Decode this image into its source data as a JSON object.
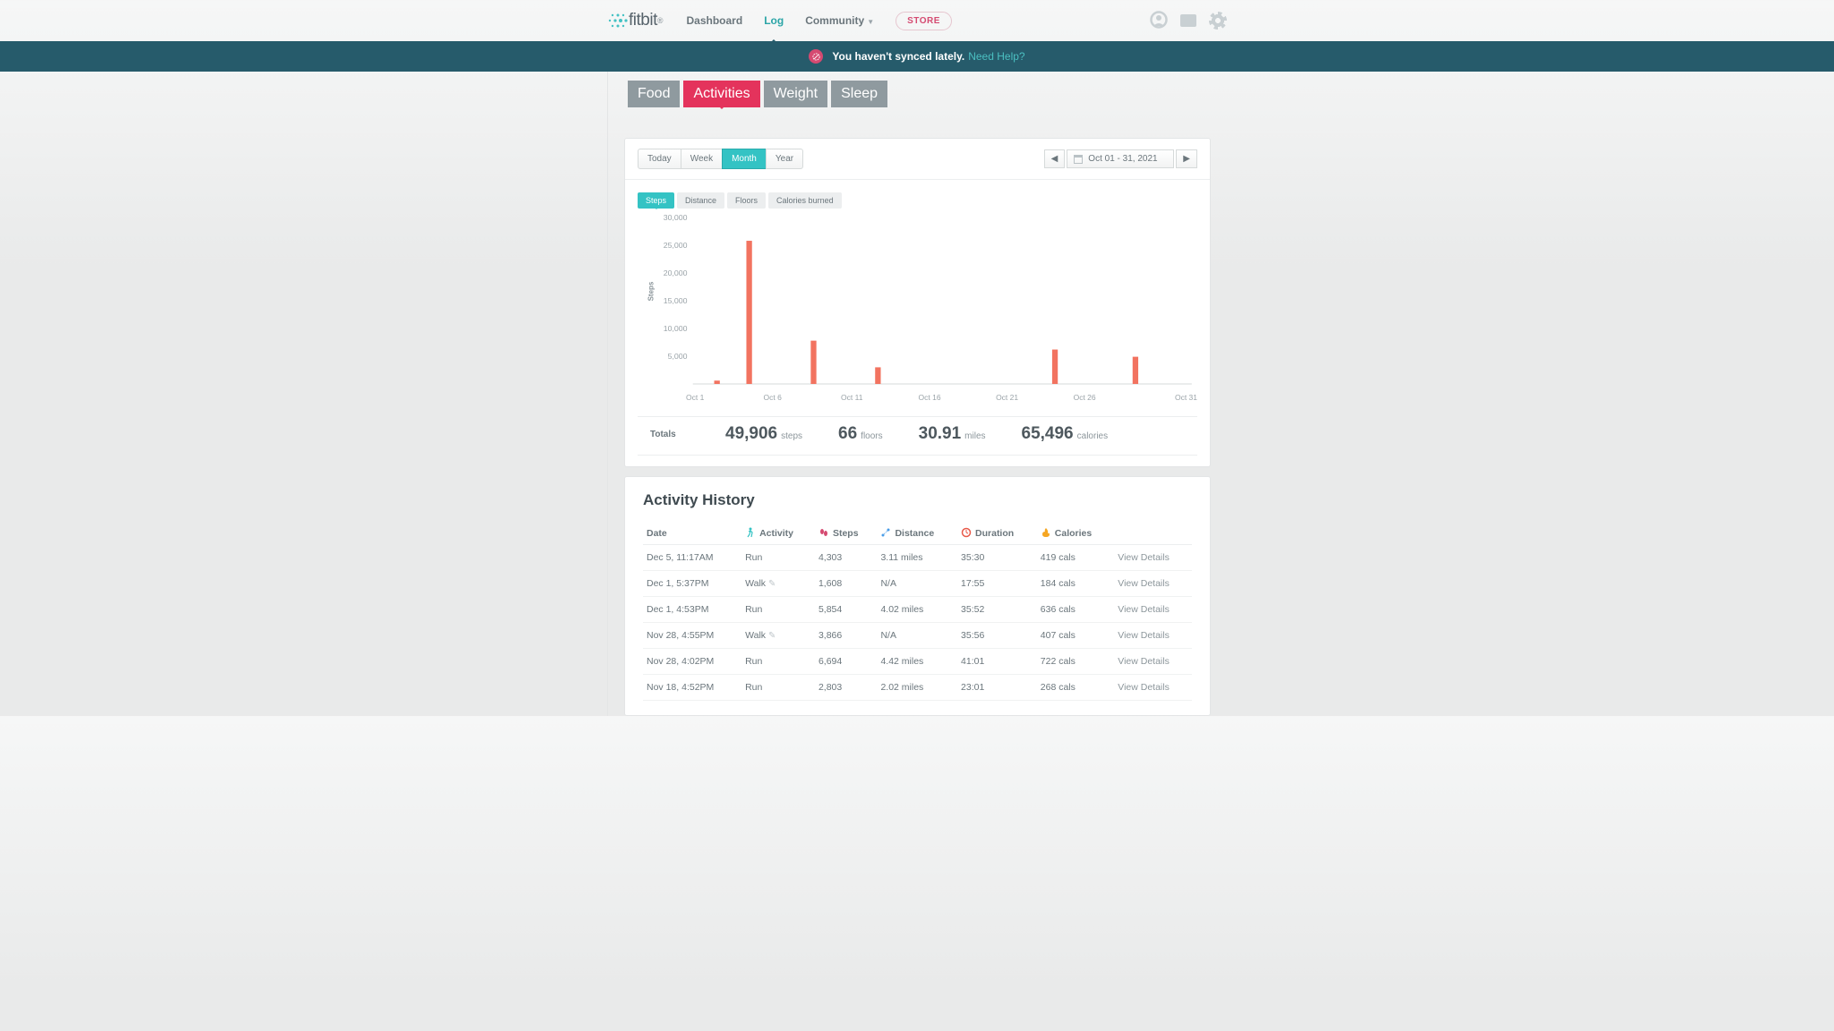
{
  "brand": "fitbit",
  "nav": {
    "dashboard": "Dashboard",
    "log": "Log",
    "community": "Community",
    "store": "STORE"
  },
  "sync_banner": {
    "message": "You haven't synced lately.",
    "help": "Need Help?"
  },
  "log_tabs": {
    "food": "Food",
    "activities": "Activities",
    "weight": "Weight",
    "sleep": "Sleep"
  },
  "period_tabs": {
    "today": "Today",
    "week": "Week",
    "month": "Month",
    "year": "Year"
  },
  "date_range": "Oct 01 - 31, 2021",
  "metric_tabs": {
    "steps": "Steps",
    "distance": "Distance",
    "floors": "Floors",
    "calories": "Calories burned"
  },
  "chart_data": {
    "type": "bar",
    "title": "",
    "xlabel": "",
    "ylabel": "Steps",
    "ylim": [
      0,
      30000
    ],
    "yticks": [
      5000,
      10000,
      15000,
      20000,
      25000,
      30000
    ],
    "ytick_labels": [
      "5,000",
      "10,000",
      "15,000",
      "20,000",
      "25,000",
      "30,000"
    ],
    "xticks": [
      "Oct 1",
      "Oct 6",
      "Oct 11",
      "Oct 16",
      "Oct 21",
      "Oct 26",
      "Oct 31"
    ],
    "categories": [
      1,
      2,
      3,
      4,
      5,
      6,
      7,
      8,
      9,
      10,
      11,
      12,
      13,
      14,
      15,
      16,
      17,
      18,
      19,
      20,
      21,
      22,
      23,
      24,
      25,
      26,
      27,
      28,
      29,
      30,
      31
    ],
    "values": [
      0,
      600,
      0,
      25800,
      0,
      0,
      0,
      7800,
      0,
      0,
      0,
      3000,
      0,
      0,
      0,
      0,
      0,
      0,
      0,
      0,
      0,
      0,
      6200,
      0,
      0,
      0,
      0,
      4900,
      0,
      0,
      0
    ]
  },
  "totals": {
    "label": "Totals",
    "steps_num": "49,906",
    "steps_unit": "steps",
    "floors_num": "66",
    "floors_unit": "floors",
    "distance_num": "30.91",
    "distance_unit": "miles",
    "calories_num": "65,496",
    "calories_unit": "calories"
  },
  "activity_history": {
    "title": "Activity History",
    "headers": {
      "date": "Date",
      "activity": "Activity",
      "steps": "Steps",
      "distance": "Distance",
      "duration": "Duration",
      "calories": "Calories"
    },
    "view_details": "View Details",
    "rows": [
      {
        "date": "Dec 5, 11:17AM",
        "activity": "Run",
        "editable": false,
        "steps": "4,303",
        "distance": "3.11 miles",
        "duration": "35:30",
        "calories": "419 cals"
      },
      {
        "date": "Dec 1, 5:37PM",
        "activity": "Walk",
        "editable": true,
        "steps": "1,608",
        "distance": "N/A",
        "duration": "17:55",
        "calories": "184 cals"
      },
      {
        "date": "Dec 1, 4:53PM",
        "activity": "Run",
        "editable": false,
        "steps": "5,854",
        "distance": "4.02 miles",
        "duration": "35:52",
        "calories": "636 cals"
      },
      {
        "date": "Nov 28, 4:55PM",
        "activity": "Walk",
        "editable": true,
        "steps": "3,866",
        "distance": "N/A",
        "duration": "35:56",
        "calories": "407 cals"
      },
      {
        "date": "Nov 28, 4:02PM",
        "activity": "Run",
        "editable": false,
        "steps": "6,694",
        "distance": "4.42 miles",
        "duration": "41:01",
        "calories": "722 cals"
      },
      {
        "date": "Nov 18, 4:52PM",
        "activity": "Run",
        "editable": false,
        "steps": "2,803",
        "distance": "2.02 miles",
        "duration": "23:01",
        "calories": "268 cals"
      }
    ]
  }
}
